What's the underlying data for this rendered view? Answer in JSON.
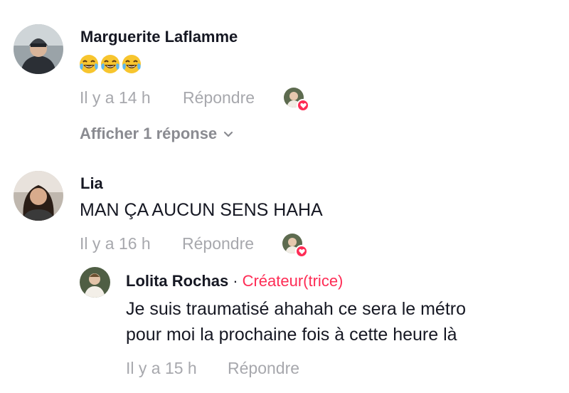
{
  "comments": [
    {
      "author": "Marguerite Laflamme",
      "emoji_text": "😂😂😂",
      "time": "Il y a 14 h",
      "reply_label": "Répondre",
      "view_replies": "Afficher 1 réponse"
    },
    {
      "author": "Lia",
      "text": "MAN ÇA AUCUN SENS HAHA",
      "time": "Il y a 16 h",
      "reply_label": "Répondre",
      "reply": {
        "author": "Lolita Rochas",
        "separator": "·",
        "badge": "Créateur(trice)",
        "line1": "Je suis traumatisé ahahah ce sera le métro",
        "line2": "pour moi la prochaine fois à cette heure là",
        "time": "Il y a 15 h",
        "reply_label": "Répondre"
      }
    }
  ],
  "colors": {
    "accent": "#fe2c55",
    "meta": "#a7a8ad",
    "text": "#161823"
  }
}
